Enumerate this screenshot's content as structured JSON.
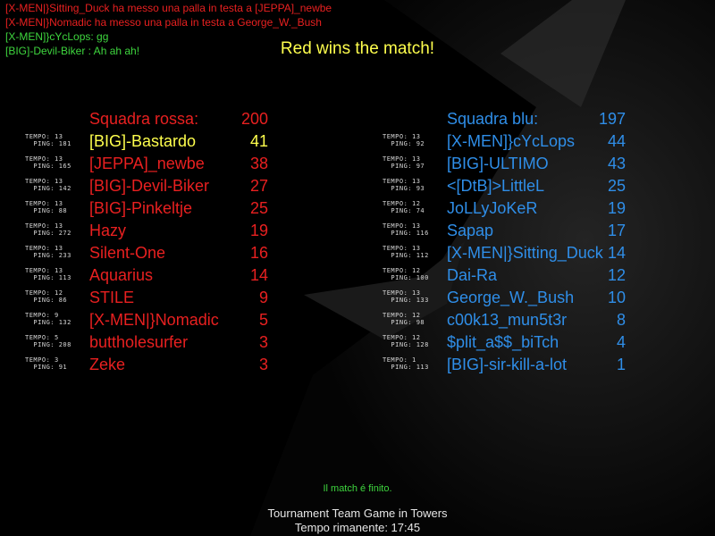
{
  "chat": [
    {
      "text": "[X-MEN|}Sitting_Duck ha messo una palla in testa a [JEPPA]_newbe",
      "color": "#e82020"
    },
    {
      "text": "[X-MEN|}Nomadic ha messo una palla in testa a George_W._Bush",
      "color": "#e82020"
    },
    {
      "text": "[X-MEN]}cYcLops: gg",
      "color": "#3ed63e"
    },
    {
      "text": "[BIG]-Devil-Biker : Ah ah ah!",
      "color": "#3ed63e"
    }
  ],
  "banner": "Red wins the match!",
  "red_team": {
    "name": "Squadra rossa:",
    "score": "200",
    "players": [
      {
        "name": "[BIG]-Bastardo",
        "score": "41",
        "time": "13",
        "ping": "181"
      },
      {
        "name": "[JEPPA]_newbe",
        "score": "38",
        "time": "13",
        "ping": "165"
      },
      {
        "name": "[BIG]-Devil-Biker",
        "score": "27",
        "time": "13",
        "ping": "142"
      },
      {
        "name": "[BIG]-Pinkeltje",
        "score": "25",
        "time": "13",
        "ping": "88"
      },
      {
        "name": "Hazy",
        "score": "19",
        "time": "13",
        "ping": "272"
      },
      {
        "name": "Silent-One",
        "score": "16",
        "time": "13",
        "ping": "233"
      },
      {
        "name": "Aquarius",
        "score": "14",
        "time": "13",
        "ping": "113"
      },
      {
        "name": "STILE",
        "score": "9",
        "time": "12",
        "ping": "86"
      },
      {
        "name": "[X-MEN|}Nomadic",
        "score": "5",
        "time": "9",
        "ping": "132"
      },
      {
        "name": "buttholesurfer",
        "score": "3",
        "time": "5",
        "ping": "208"
      },
      {
        "name": "Zeke",
        "score": "3",
        "time": "3",
        "ping": "91"
      }
    ]
  },
  "blue_team": {
    "name": "Squadra blu:",
    "score": "197",
    "players": [
      {
        "name": "[X-MEN]}cYcLops",
        "score": "44",
        "time": "13",
        "ping": "92"
      },
      {
        "name": "[BIG]-ULTIMO",
        "score": "43",
        "time": "13",
        "ping": "97"
      },
      {
        "name": "<[DtB]>LittleL",
        "score": "25",
        "time": "13",
        "ping": "93"
      },
      {
        "name": "JoLLyJoKeR",
        "score": "19",
        "time": "12",
        "ping": "74"
      },
      {
        "name": "Sapap",
        "score": "17",
        "time": "13",
        "ping": "116"
      },
      {
        "name": "[X-MEN|}Sitting_Duck",
        "score": "14",
        "time": "13",
        "ping": "112"
      },
      {
        "name": "Dai-Ra",
        "score": "12",
        "time": "12",
        "ping": "100"
      },
      {
        "name": "George_W._Bush",
        "score": "10",
        "time": "13",
        "ping": "133"
      },
      {
        "name": "c00k13_mun5t3r",
        "score": "8",
        "time": "12",
        "ping": "98"
      },
      {
        "name": "$plit_a$$_biTch",
        "score": "4",
        "time": "12",
        "ping": "128"
      },
      {
        "name": "[BIG]-sir-kill-a-lot",
        "score": "1",
        "time": "1",
        "ping": "113"
      }
    ]
  },
  "labels": {
    "time": "TEMPO:",
    "ping": "PING:"
  },
  "match_finished": "Il match é finito.",
  "game_type": "Tournament Team Game in Towers",
  "time_remaining": "Tempo rimanente:  17:45",
  "colors": {
    "red": "#e82020",
    "blue": "#2f8ee8",
    "highlight": "#ffff4d",
    "chat_green": "#3ed63e"
  }
}
